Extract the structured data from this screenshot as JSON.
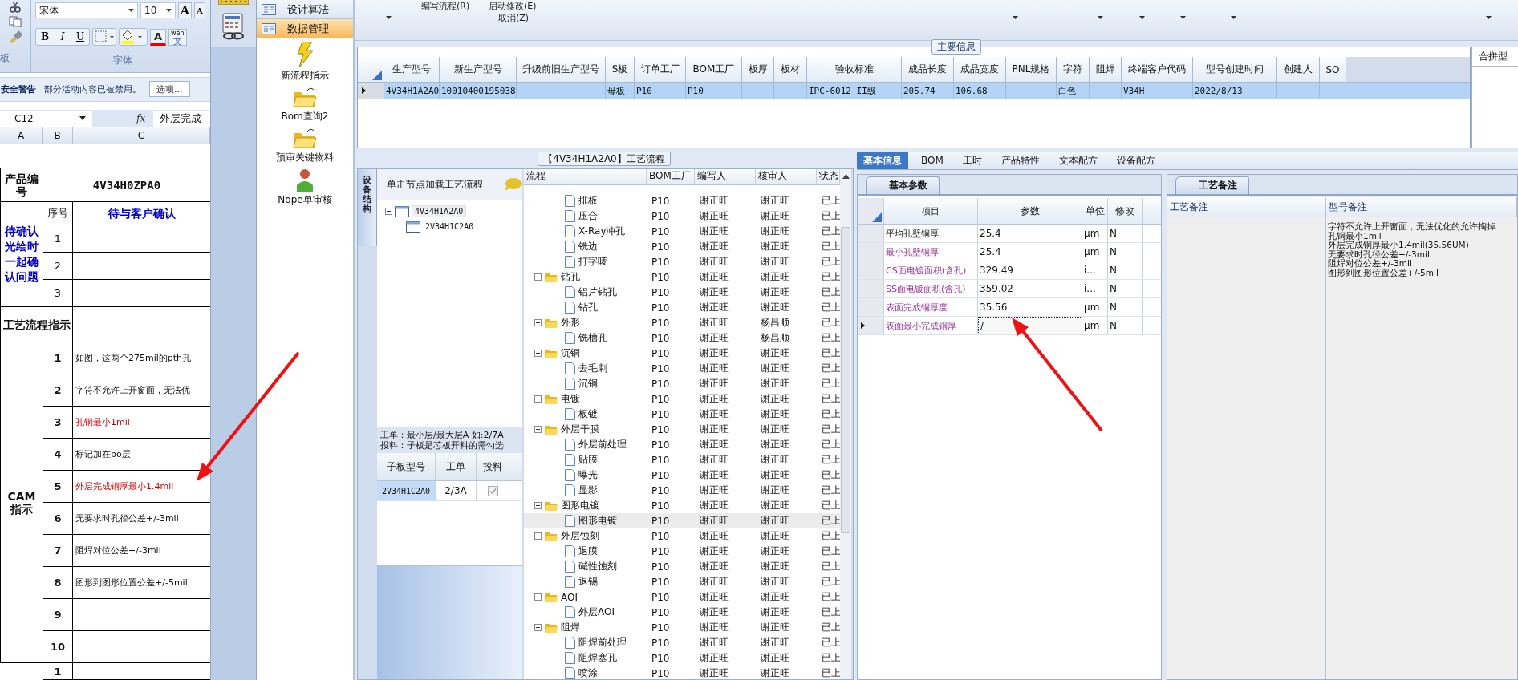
{
  "excel": {
    "ribbon": {
      "clipboard_label": "板",
      "font_name": "宋体",
      "font_size": "10",
      "size_buttons": [
        "A",
        "A"
      ],
      "format_buttons": [
        "B",
        "I",
        "U"
      ],
      "font_color_button": "A",
      "phonetic_pinyin": "wén",
      "phonetic_char": "文",
      "font_group_label": "字体"
    },
    "security_bar": {
      "title": "安全警告",
      "message": "部分活动内容已被禁用。",
      "button": "选项..."
    },
    "formula_bar": {
      "name_box": "C12",
      "function_label": "fx",
      "formula": "外层完成"
    },
    "column_headers": [
      "A",
      "B",
      "C"
    ],
    "sheet": {
      "product_label": "产品编号",
      "product_code": "4V34H0ZPA0",
      "seq_label": "序号",
      "confirm_header": "待与客户确认",
      "confirm_label": "待确认光绘时一起确认问题",
      "confirm_rows": [
        "1",
        "2",
        "3"
      ],
      "flow_label": "工艺流程指示",
      "cam_label": "CAM指示",
      "cam_rows": [
        {
          "no": "1",
          "text": "如图，这两个275mil的pth孔",
          "highlighted": false
        },
        {
          "no": "2",
          "text": "字符不允许上开窗面，无法优",
          "highlighted": false
        },
        {
          "no": "3",
          "text": "孔铜最小1mil",
          "highlighted": true
        },
        {
          "no": "4",
          "text": "标记加在bo层",
          "highlighted": false
        },
        {
          "no": "5",
          "text": "外层完成铜厚最小1.4mil",
          "highlighted": true
        },
        {
          "no": "6",
          "text": "无要求时孔径公差+/-3mil",
          "highlighted": false
        },
        {
          "no": "7",
          "text": "阻焊对位公差+/-3mil",
          "highlighted": false
        },
        {
          "no": "8",
          "text": "图形到图形位置公差+/-5mil",
          "highlighted": false
        },
        {
          "no": "9"
        },
        {
          "no": "10"
        }
      ],
      "next_row": "1"
    }
  },
  "sidebar": {
    "sections": [
      {
        "label": "设计算法",
        "selected": false
      },
      {
        "label": "数据管理",
        "selected": true
      }
    ],
    "items": [
      {
        "label": "新流程指示",
        "kind": "lightning"
      },
      {
        "label": "Bom查询2",
        "kind": "folder"
      },
      {
        "label": "预审关键物料",
        "kind": "folder"
      },
      {
        "label": "Nope单审核",
        "kind": "person"
      }
    ]
  },
  "toolbar": {
    "menu_items": [
      "编写流程(R)",
      "启动修改(E)",
      "取消(Z)"
    ]
  },
  "main_info": {
    "title": "主要信息",
    "columns": [
      {
        "header": "生产型号",
        "value": "4V34H1A2A0"
      },
      {
        "header": "新生产型号",
        "value": "10010400195038"
      },
      {
        "header": "升级前旧生产型号"
      },
      {
        "header": "S板",
        "value": "母板"
      },
      {
        "header": "订单工厂",
        "value": "P10"
      },
      {
        "header": "BOM工厂",
        "value": "P10"
      },
      {
        "header": "板厚"
      },
      {
        "header": "板材"
      },
      {
        "header": "验收标准",
        "value": "IPC-6012 II级"
      },
      {
        "header": "成品长度",
        "value": "205.74"
      },
      {
        "header": "成品宽度",
        "value": "106.68"
      },
      {
        "header": "PNL规格"
      },
      {
        "header": "字符",
        "value": "白色"
      },
      {
        "header": "阻焊"
      },
      {
        "header": "终端客户代码",
        "value": "V34H"
      },
      {
        "header": "型号创建时间",
        "value": "2022/8/13"
      },
      {
        "header": "创建人"
      },
      {
        "header": "SO"
      }
    ],
    "side_panel_title": "合拼型"
  },
  "process": {
    "title": "【4V34H1A2A0】工艺流程",
    "side_tab": "设备结构",
    "hint": "单击节点加载工艺流程",
    "model_tree": [
      {
        "label": "4V34H1A2A0",
        "expanded": true,
        "children": [
          {
            "label": "2V34H1C2A0"
          }
        ]
      }
    ],
    "note_lines": [
      "工单：最小层/最大层A 如:2/7A",
      "投料：子板是芯板开料的需勾选"
    ],
    "sub_columns": [
      "子板型号",
      "工单",
      "投料"
    ],
    "sub_rows": [
      {
        "model": "2V34H1C2A0",
        "order": "2/3A",
        "checked": true
      }
    ],
    "flow_columns": [
      "流程",
      "BOM工厂",
      "编写人",
      "核审人",
      "状态"
    ],
    "flow_rows": [
      {
        "kind": "step",
        "name": "排板",
        "bom": "P10",
        "writer": "谢正旺",
        "reviewer": "谢正旺",
        "status": "已上",
        "selected": false
      },
      {
        "kind": "step",
        "name": "压合",
        "bom": "P10",
        "writer": "谢正旺",
        "reviewer": "谢正旺",
        "status": "已上",
        "selected": false
      },
      {
        "kind": "step",
        "name": "X-Ray冲孔",
        "bom": "P10",
        "writer": "谢正旺",
        "reviewer": "谢正旺",
        "status": "已上",
        "selected": false
      },
      {
        "kind": "step",
        "name": "铣边",
        "bom": "P10",
        "writer": "谢正旺",
        "reviewer": "谢正旺",
        "status": "已上",
        "selected": false
      },
      {
        "kind": "step",
        "name": "打字唛",
        "bom": "P10",
        "writer": "谢正旺",
        "reviewer": "谢正旺",
        "status": "已上",
        "selected": false
      },
      {
        "kind": "folder",
        "name": "钻孔",
        "bom": "P10",
        "writer": "谢正旺",
        "reviewer": "谢正旺",
        "status": "已上",
        "selected": false,
        "expanded": true,
        "children": [
          {
            "kind": "step",
            "name": "铝片钻孔",
            "bom": "P10",
            "writer": "谢正旺",
            "reviewer": "谢正旺",
            "status": "已上",
            "selected": false
          },
          {
            "kind": "step",
            "name": "钻孔",
            "bom": "P10",
            "writer": "谢正旺",
            "reviewer": "谢正旺",
            "status": "已上",
            "selected": false
          }
        ]
      },
      {
        "kind": "folder",
        "name": "外形",
        "bom": "P10",
        "writer": "谢正旺",
        "reviewer": "杨昌顺",
        "status": "已上",
        "selected": false,
        "expanded": true,
        "children": [
          {
            "kind": "step",
            "name": "铣槽孔",
            "bom": "P10",
            "writer": "谢正旺",
            "reviewer": "杨昌顺",
            "status": "已上",
            "selected": false
          }
        ]
      },
      {
        "kind": "folder",
        "name": "沉铜",
        "bom": "P10",
        "writer": "谢正旺",
        "reviewer": "谢正旺",
        "status": "已上",
        "selected": false,
        "expanded": true,
        "children": [
          {
            "kind": "step",
            "name": "去毛刺",
            "bom": "P10",
            "writer": "谢正旺",
            "reviewer": "谢正旺",
            "status": "已上",
            "selected": false
          },
          {
            "kind": "step",
            "name": "沉铜",
            "bom": "P10",
            "writer": "谢正旺",
            "reviewer": "谢正旺",
            "status": "已上",
            "selected": false
          }
        ]
      },
      {
        "kind": "folder",
        "name": "电镀",
        "bom": "P10",
        "writer": "谢正旺",
        "reviewer": "谢正旺",
        "status": "已上",
        "selected": false,
        "expanded": true,
        "children": [
          {
            "kind": "step",
            "name": "板镀",
            "bom": "P10",
            "writer": "谢正旺",
            "reviewer": "谢正旺",
            "status": "已上",
            "selected": false
          }
        ]
      },
      {
        "kind": "folder",
        "name": "外层干膜",
        "bom": "P10",
        "writer": "谢正旺",
        "reviewer": "谢正旺",
        "status": "已上",
        "selected": false,
        "expanded": true,
        "children": [
          {
            "kind": "step",
            "name": "外层前处理",
            "bom": "P10",
            "writer": "谢正旺",
            "reviewer": "谢正旺",
            "status": "已上",
            "selected": false
          },
          {
            "kind": "step",
            "name": "贴膜",
            "bom": "P10",
            "writer": "谢正旺",
            "reviewer": "谢正旺",
            "status": "已上",
            "selected": false
          },
          {
            "kind": "step",
            "name": "曝光",
            "bom": "P10",
            "writer": "谢正旺",
            "reviewer": "谢正旺",
            "status": "已上",
            "selected": false
          },
          {
            "kind": "step",
            "name": "显影",
            "bom": "P10",
            "writer": "谢正旺",
            "reviewer": "谢正旺",
            "status": "已上",
            "selected": false
          }
        ]
      },
      {
        "kind": "folder",
        "name": "图形电镀",
        "bom": "P10",
        "writer": "谢正旺",
        "reviewer": "谢正旺",
        "status": "已上",
        "selected": false,
        "expanded": true,
        "children": [
          {
            "kind": "step",
            "name": "图形电镀",
            "bom": "P10",
            "writer": "谢正旺",
            "reviewer": "谢正旺",
            "status": "已上",
            "selected": true
          }
        ]
      },
      {
        "kind": "folder",
        "name": "外层蚀刻",
        "bom": "P10",
        "writer": "谢正旺",
        "reviewer": "谢正旺",
        "status": "已上",
        "selected": false,
        "expanded": true,
        "children": [
          {
            "kind": "step",
            "name": "退膜",
            "bom": "P10",
            "writer": "谢正旺",
            "reviewer": "谢正旺",
            "status": "已上",
            "selected": false
          },
          {
            "kind": "step",
            "name": "碱性蚀刻",
            "bom": "P10",
            "writer": "谢正旺",
            "reviewer": "谢正旺",
            "status": "已上",
            "selected": false
          },
          {
            "kind": "step",
            "name": "退锡",
            "bom": "P10",
            "writer": "谢正旺",
            "reviewer": "谢正旺",
            "status": "已上",
            "selected": false
          }
        ]
      },
      {
        "kind": "folder",
        "name": "AOI",
        "bom": "P10",
        "writer": "谢正旺",
        "reviewer": "谢正旺",
        "status": "已上",
        "selected": false,
        "expanded": true,
        "children": [
          {
            "kind": "step",
            "name": "外层AOI",
            "bom": "P10",
            "writer": "谢正旺",
            "reviewer": "谢正旺",
            "status": "已上",
            "selected": false
          }
        ]
      },
      {
        "kind": "folder",
        "name": "阻焊",
        "bom": "P10",
        "writer": "谢正旺",
        "reviewer": "谢正旺",
        "status": "已上",
        "selected": false,
        "expanded": true,
        "children": [
          {
            "kind": "step",
            "name": "阻焊前处理",
            "bom": "P10",
            "writer": "谢正旺",
            "reviewer": "谢正旺",
            "status": "已上",
            "selected": false
          },
          {
            "kind": "step",
            "name": "阻焊塞孔",
            "bom": "P10",
            "writer": "谢正旺",
            "reviewer": "谢正旺",
            "status": "已上",
            "selected": false
          },
          {
            "kind": "step",
            "name": "喷涂",
            "bom": "P10",
            "writer": "谢正旺",
            "reviewer": "谢正旺",
            "status": "已上",
            "selected": false
          }
        ]
      }
    ]
  },
  "details": {
    "tabs": [
      {
        "label": "基本信息",
        "selected": true
      },
      {
        "label": "BOM",
        "selected": false
      },
      {
        "label": "工时",
        "selected": false
      },
      {
        "label": "产品特性",
        "selected": false
      },
      {
        "label": "文本配方",
        "selected": false
      },
      {
        "label": "设备配方",
        "selected": false
      }
    ],
    "sub_tab": "基本参数",
    "columns": [
      "项目",
      "参数",
      "单位",
      "修改"
    ],
    "rows": [
      {
        "name": "平均孔壁铜厚",
        "highlighted": false,
        "value": "25.4",
        "unit": "μm",
        "modified": "N",
        "current": false
      },
      {
        "name": "最小孔壁铜厚",
        "highlighted": true,
        "value": "25.4",
        "unit": "μm",
        "modified": "N",
        "current": false
      },
      {
        "name": "CS面电镀面积(含孔)",
        "highlighted": true,
        "value": "329.49",
        "unit": "i...",
        "modified": "N",
        "current": false
      },
      {
        "name": "SS面电镀面积(含孔)",
        "highlighted": true,
        "value": "359.02",
        "unit": "i...",
        "modified": "N",
        "current": false
      },
      {
        "name": "表面完成铜厚度",
        "highlighted": true,
        "value": "35.56",
        "unit": "μm",
        "modified": "N",
        "current": false
      },
      {
        "name": "表面最小完成铜厚",
        "highlighted": true,
        "value": "/",
        "unit": "μm",
        "modified": "N",
        "current": true
      }
    ],
    "remarks": {
      "tab": "工艺备注",
      "columns": [
        "工艺备注",
        "型号备注"
      ],
      "model_note_lines": [
        "字符不允许上开窗面，无法优化的允许掏掉",
        "孔铜最小1mil",
        "外层完成铜厚最小1.4mil(35.56UM)",
        "无要求时孔径公差+/-3mil",
        "阻焊对位公差+/-3mil",
        "图形到图形位置公差+/-5mil"
      ]
    }
  }
}
